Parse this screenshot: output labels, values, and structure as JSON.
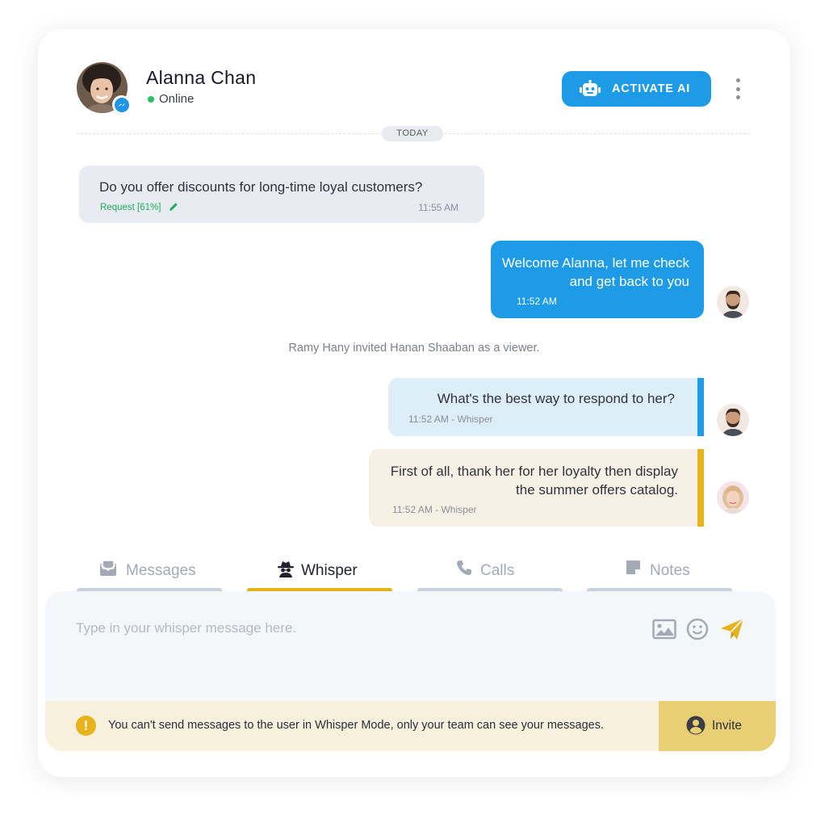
{
  "contact": {
    "name": "Alanna Chan",
    "status": "Online",
    "channel_icon": "messenger-icon"
  },
  "header": {
    "activate_ai_label": "ACTIVATE AI",
    "menu_icon": "kebab-menu-icon"
  },
  "divider": {
    "label": "TODAY"
  },
  "messages": [
    {
      "direction": "incoming",
      "text": "Do you offer discounts for long-time loyal customers?",
      "tag": "Request [61%]",
      "time": "11:55 AM"
    },
    {
      "direction": "outgoing",
      "text": "Welcome Alanna, let me check and get back to you",
      "time": "11:52 AM"
    },
    {
      "direction": "system",
      "text": "Ramy Hany invited Hanan Shaaban as a viewer."
    },
    {
      "direction": "whisper",
      "text": "What's the best way to respond to her?",
      "time": "11:52 AM - Whisper"
    },
    {
      "direction": "whisper",
      "text": "First of all, thank her for her loyalty then display the summer offers catalog.",
      "time": "11:52 AM - Whisper"
    }
  ],
  "tabs": [
    {
      "label": "Messages",
      "icon": "messages-icon",
      "active": false
    },
    {
      "label": "Whisper",
      "icon": "spy-icon",
      "active": true
    },
    {
      "label": "Calls",
      "icon": "phone-icon",
      "active": false
    },
    {
      "label": "Notes",
      "icon": "note-icon",
      "active": false
    }
  ],
  "composer": {
    "placeholder": "Type in your whisper message here.",
    "value": ""
  },
  "notice": {
    "text": "You can't send messages to the user in Whisper Mode, only your team can see your messages.",
    "invite_label": "Invite"
  },
  "colors": {
    "primary_blue": "#1e9be6",
    "whisper_yellow": "#e8b21a",
    "online_green": "#22c35e",
    "invite_bg": "#e8cf74"
  }
}
